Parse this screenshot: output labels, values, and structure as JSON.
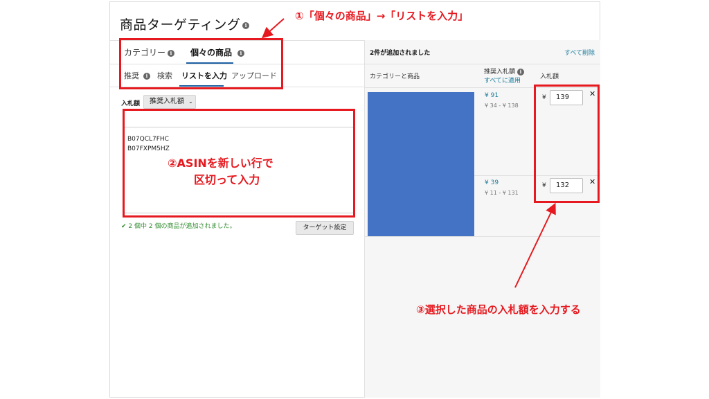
{
  "title": "商品ターゲティング",
  "main_tabs": [
    {
      "label": "カテゴリー"
    },
    {
      "label": "個々の商品"
    }
  ],
  "sub_tabs": [
    {
      "label": "推奨"
    },
    {
      "label": "検索"
    },
    {
      "label": "リストを入力"
    },
    {
      "label": "アップロード"
    }
  ],
  "bid_label": "入札額",
  "bid_dropdown": "推奨入札額",
  "textarea_lines": [
    "B07QCL7FHC",
    "B07FXPM5HZ"
  ],
  "status_text": "2 個中 2 個の商品が追加されました。",
  "target_button": "ターゲット設定",
  "right": {
    "header": "2件が追加されました",
    "remove_all": "すべて削除",
    "col_product": "カテゴリーと商品",
    "col_suggested": "推奨入札額",
    "apply_all": "すべてに適用",
    "col_bid": "入札額",
    "rows": [
      {
        "suggested": "¥ 91",
        "range": "¥ 34 - ¥ 138",
        "currency": "¥",
        "bid": "139"
      },
      {
        "suggested": "¥ 39",
        "range": "¥ 11 - ¥ 131",
        "currency": "¥",
        "bid": "132"
      }
    ]
  },
  "annotations": {
    "a1": "①「個々の商品」→「リストを入力」",
    "a2_line1": "②ASINを新しい行で",
    "a2_line2": "区切って入力",
    "a3": "③選択した商品の入札額を入力する"
  },
  "colors": {
    "accent_red": "#e5191f",
    "tab_underline": "#1d5fa3",
    "link": "#1a7c9c",
    "image_placeholder": "#4472c4"
  }
}
